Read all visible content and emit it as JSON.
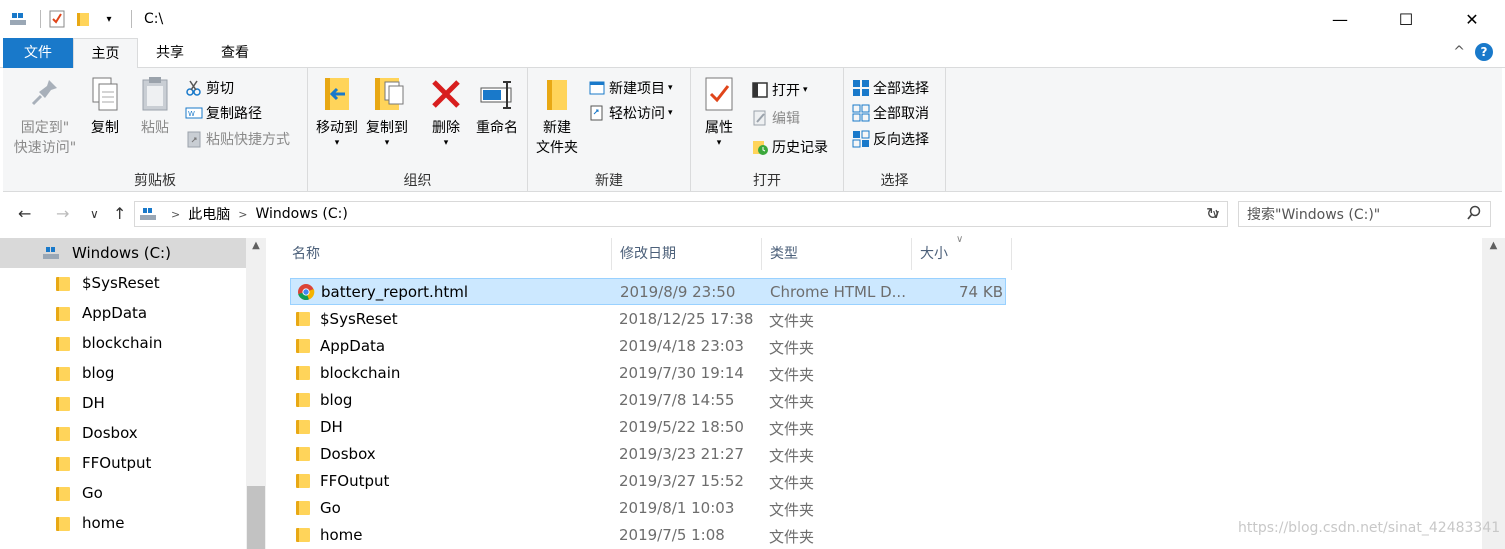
{
  "window": {
    "title": "C:\\"
  },
  "titlebar": {
    "minimize": "—",
    "maximize": "☐",
    "close": "✕",
    "dropdown": "▾"
  },
  "tabs": {
    "file": "文件",
    "home": "主页",
    "share": "共享",
    "view": "查看",
    "collapse": "^",
    "help": "?"
  },
  "ribbon": {
    "clipboard": {
      "label": "剪贴板",
      "pin_line1": "固定到\"",
      "pin_line2": "快速访问\"",
      "copy": "复制",
      "paste": "粘贴",
      "cut": "剪切",
      "copy_path": "复制路径",
      "paste_shortcut": "粘贴快捷方式"
    },
    "organize": {
      "label": "组织",
      "move_to": "移动到",
      "copy_to": "复制到",
      "delete": "删除",
      "rename": "重命名",
      "arrow": "▾"
    },
    "new": {
      "label": "新建",
      "new_folder_line1": "新建",
      "new_folder_line2": "文件夹",
      "new_item": "新建项目",
      "easy_access": "轻松访问"
    },
    "open": {
      "label": "打开",
      "properties": "属性",
      "open": "打开",
      "edit": "编辑",
      "history": "历史记录"
    },
    "select": {
      "label": "选择",
      "select_all": "全部选择",
      "select_none": "全部取消",
      "invert": "反向选择"
    }
  },
  "address": {
    "back": "←",
    "forward": "→",
    "recent": "∨",
    "up": "↑",
    "crumbs": [
      "此电脑",
      "Windows (C:)"
    ],
    "chevron": ">",
    "refresh": "↻",
    "search_placeholder": "搜索\"Windows (C:)\""
  },
  "navpane": {
    "items": [
      {
        "label": "Windows (C:)",
        "selected": true
      },
      {
        "label": "$SysReset"
      },
      {
        "label": "AppData"
      },
      {
        "label": "blockchain"
      },
      {
        "label": "blog"
      },
      {
        "label": "DH"
      },
      {
        "label": "Dosbox"
      },
      {
        "label": "FFOutput"
      },
      {
        "label": "Go"
      },
      {
        "label": "home"
      }
    ]
  },
  "filelist": {
    "headers": {
      "name": "名称",
      "date": "修改日期",
      "type": "类型",
      "size": "大小"
    },
    "rows": [
      {
        "name": "battery_report.html",
        "date": "2019/8/9 23:50",
        "type": "Chrome HTML D...",
        "size": "74 KB",
        "icon": "chrome-icon",
        "selected": true
      },
      {
        "name": "$SysReset",
        "date": "2018/12/25 17:38",
        "type": "文件夹",
        "size": "",
        "icon": "folder-icon"
      },
      {
        "name": "AppData",
        "date": "2019/4/18 23:03",
        "type": "文件夹",
        "size": "",
        "icon": "folder-icon"
      },
      {
        "name": "blockchain",
        "date": "2019/7/30 19:14",
        "type": "文件夹",
        "size": "",
        "icon": "folder-icon"
      },
      {
        "name": "blog",
        "date": "2019/7/8 14:55",
        "type": "文件夹",
        "size": "",
        "icon": "folder-icon"
      },
      {
        "name": "DH",
        "date": "2019/5/22 18:50",
        "type": "文件夹",
        "size": "",
        "icon": "folder-icon"
      },
      {
        "name": "Dosbox",
        "date": "2019/3/23 21:27",
        "type": "文件夹",
        "size": "",
        "icon": "folder-icon"
      },
      {
        "name": "FFOutput",
        "date": "2019/3/27 15:52",
        "type": "文件夹",
        "size": "",
        "icon": "folder-icon"
      },
      {
        "name": "Go",
        "date": "2019/8/1 10:03",
        "type": "文件夹",
        "size": "",
        "icon": "folder-icon"
      },
      {
        "name": "home",
        "date": "2019/7/5 1:08",
        "type": "文件夹",
        "size": "",
        "icon": "folder-icon"
      }
    ]
  },
  "watermark": "https://blog.csdn.net/sinat_42483341",
  "colors": {
    "accent": "#1979ca",
    "selection": "#cce8ff",
    "selection_border": "#99d1ff",
    "folder": "#ffd45a"
  }
}
